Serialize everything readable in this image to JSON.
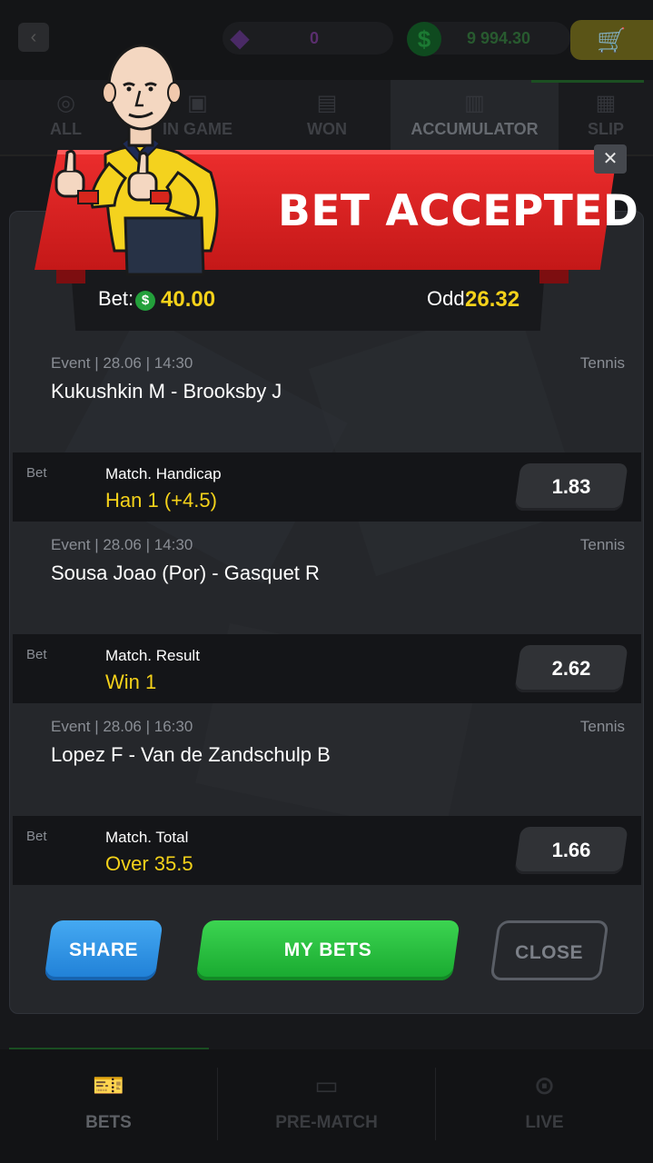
{
  "topbar": {
    "gem_value": "0",
    "cash_value": "9 994.30"
  },
  "tabs": [
    {
      "label": "ALL"
    },
    {
      "label": "IN GAME"
    },
    {
      "label": "WON"
    },
    {
      "label": "ACCUMULATOR"
    },
    {
      "label": "SLIP"
    }
  ],
  "banner": {
    "title": "BET ACCEPTED"
  },
  "summary": {
    "bet_label": "Bet:",
    "bet_currency_symbol": "$",
    "bet_value": "40.00",
    "odd_label": "Odd:",
    "odd_value": "26.32"
  },
  "events": [
    {
      "label": "Event  |  28.06  |  14:30",
      "sport": "Tennis",
      "teams": "Kukushkin M - Brooksby J",
      "bet_tag": "Bet",
      "market": "Match. Handicap",
      "pick": "Han 1 (+4.5)",
      "odd": "1.83"
    },
    {
      "label": "Event  |  28.06  |  14:30",
      "sport": "Tennis",
      "teams": "Sousa Joao (Por) - Gasquet R",
      "bet_tag": "Bet",
      "market": "Match. Result",
      "pick": "Win 1",
      "odd": "2.62"
    },
    {
      "label": "Event  |  28.06  |  16:30",
      "sport": "Tennis",
      "teams": "Lopez F - Van de Zandschulp B",
      "bet_tag": "Bet",
      "market": "Match. Total",
      "pick": "Over 35.5",
      "odd": "1.66"
    }
  ],
  "actions": {
    "share": "SHARE",
    "my_bets": "MY BETS",
    "close": "CLOSE"
  },
  "bottom_nav": [
    {
      "label": "BETS",
      "icon": "ticket-icon"
    },
    {
      "label": "PRE-MATCH",
      "icon": "scoreboard-icon"
    },
    {
      "label": "LIVE",
      "icon": "live-icon"
    }
  ],
  "colors": {
    "accent_yellow": "#f5d21a",
    "banner_red": "#d92222",
    "share_blue": "#2f95e6",
    "mybets_green": "#26be3e"
  }
}
